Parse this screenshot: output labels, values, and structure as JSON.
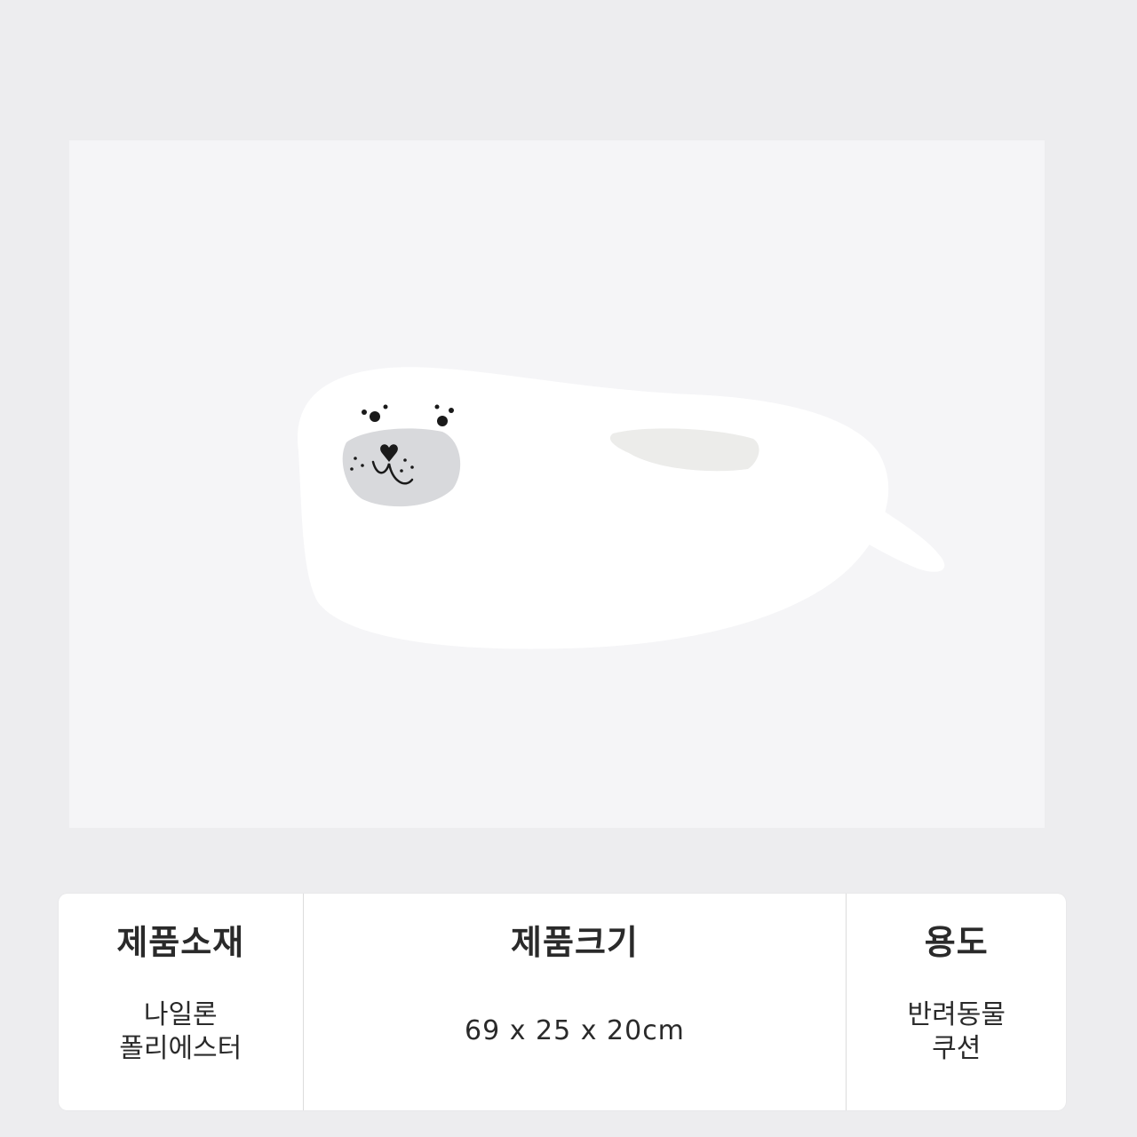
{
  "colors": {
    "page_background": "#ededef",
    "panel_background": "#f5f5f7",
    "card_background": "#ffffff",
    "text": "#2a2a2a",
    "seal_body": "#ffffff",
    "seal_muzzle": "#d8d9dc"
  },
  "specs": {
    "material": {
      "heading": "제품소재",
      "lines": [
        "나일론",
        "폴리에스터"
      ]
    },
    "size": {
      "heading": "제품크기",
      "value": "69 x 25 x 20cm"
    },
    "usage": {
      "heading": "용도",
      "lines": [
        "반려동물",
        "쿠션"
      ]
    }
  }
}
